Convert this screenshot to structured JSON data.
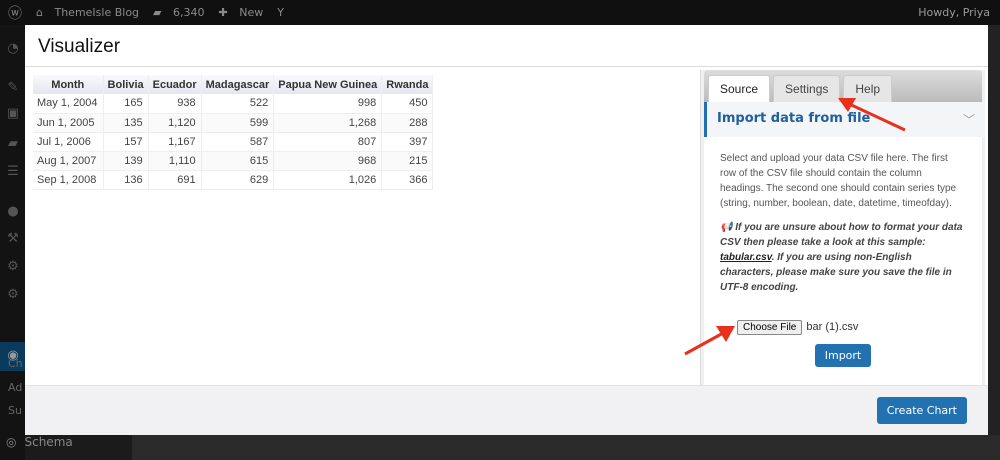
{
  "adminbar": {
    "site": "ThemeIsle Blog",
    "comments": "6,340",
    "new": "New",
    "howdy": "Howdy, Priya"
  },
  "sidebar": {
    "submenu": [
      "Ch",
      "Ad",
      "Su"
    ],
    "schema": "Schema"
  },
  "modal": {
    "title": "Visualizer"
  },
  "table": {
    "columns": [
      "Month",
      "Bolivia",
      "Ecuador",
      "Madagascar",
      "Papua New Guinea",
      "Rwanda"
    ],
    "rows": [
      [
        "May 1, 2004",
        "165",
        "938",
        "522",
        "998",
        "450"
      ],
      [
        "Jun 1, 2005",
        "135",
        "1,120",
        "599",
        "1,268",
        "288"
      ],
      [
        "Jul 1, 2006",
        "157",
        "1,167",
        "587",
        "807",
        "397"
      ],
      [
        "Aug 1, 2007",
        "139",
        "1,110",
        "615",
        "968",
        "215"
      ],
      [
        "Sep 1, 2008",
        "136",
        "691",
        "629",
        "1,026",
        "366"
      ]
    ]
  },
  "panel": {
    "tabs": [
      "Source",
      "Settings",
      "Help"
    ],
    "section_title": "Import data from file",
    "description": "Select and upload your data CSV file here. The first row of the CSV file should contain the column headings. The second one should contain series type (string, number, boolean, date, datetime, timeofday).",
    "note_before": " If you are unsure about how to format your data CSV then please take a look at this sample: ",
    "note_link": "tabular.csv",
    "note_after": ". If you are using non-English characters, please make sure you save the file in UTF-8 encoding.",
    "choose_file": "Choose File",
    "file_name": "bar (1).csv",
    "import": "Import"
  },
  "footer": {
    "create": "Create Chart"
  },
  "colors": {
    "accent": "#2271b1",
    "arrow": "#e8301c"
  }
}
